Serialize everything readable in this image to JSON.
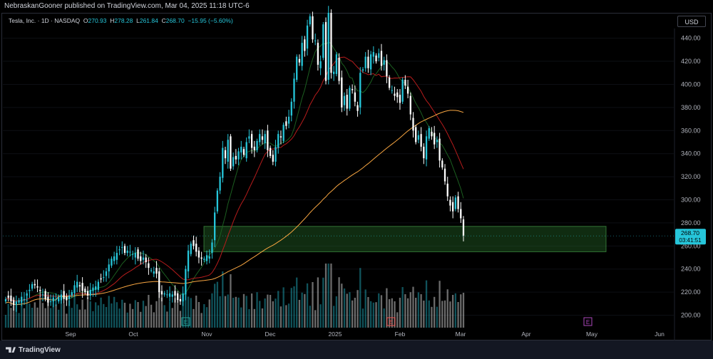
{
  "header": {
    "published": "NebraskanGooner published on TradingView.com, Mar 04, 2025 11:18 UTC-6"
  },
  "legend": {
    "symbol": "Tesla, Inc. · 1D · NASDAQ",
    "o_label": "O",
    "o": "270.93",
    "h_label": "H",
    "h": "278.28",
    "l_label": "L",
    "l": "261.84",
    "c_label": "C",
    "c": "268.70",
    "chg": "−15.95 (−5.60%)"
  },
  "currency": "USD",
  "price_label": {
    "price": "268.70",
    "countdown": "03:41:51"
  },
  "footer": {
    "brand": "TradingView"
  },
  "colors": {
    "up": "#26c6da",
    "down": "#ffffff",
    "ma_fast": "#1b5e20",
    "ma_mid": "#b71c1c",
    "ma_slow": "#f7a541",
    "zone": "#2e7d32",
    "earnings_green": "#26a69a",
    "earnings_red": "#ef5350",
    "earnings_purple": "#ab47bc"
  },
  "chart_data": {
    "type": "candlestick",
    "y_ticks": [
      200,
      220,
      240,
      260,
      280,
      300,
      320,
      340,
      360,
      380,
      400,
      420,
      440
    ],
    "y_tick_labels": [
      "200.00",
      "220.00",
      "240.00",
      "260.00",
      "280.00",
      "300.00",
      "320.00",
      "340.00",
      "360.00",
      "380.00",
      "400.00",
      "420.00",
      "440.00"
    ],
    "ylim": [
      188,
      462
    ],
    "x_labels": [
      "Sep",
      "Oct",
      "Nov",
      "Dec",
      "2025",
      "Feb",
      "Mar",
      "Apr",
      "May",
      "Jun"
    ],
    "last_close": 268.7,
    "support_zone": {
      "low": 255,
      "high": 277
    },
    "earnings_markers": [
      {
        "label": "E",
        "kind": "past"
      },
      {
        "label": "E",
        "kind": "past-red"
      },
      {
        "label": "E",
        "kind": "upcoming"
      }
    ],
    "closes": [
      214,
      215,
      212,
      209,
      212,
      213,
      216,
      214,
      219,
      222,
      227,
      226,
      224,
      221,
      218,
      214,
      211,
      212,
      215,
      214,
      216,
      218,
      214,
      213,
      217,
      220,
      226,
      229,
      225,
      221,
      220,
      217,
      222,
      224,
      225,
      229,
      231,
      233,
      238,
      244,
      249,
      251,
      254,
      257,
      259,
      254,
      256,
      255,
      253,
      254,
      249,
      247,
      250,
      246,
      241,
      239,
      238,
      236,
      220,
      218,
      219,
      218,
      219,
      218,
      217,
      213,
      212,
      219,
      240,
      256,
      262,
      260,
      255,
      250,
      249,
      249,
      252,
      251,
      263,
      289,
      308,
      320,
      345,
      336,
      352,
      327,
      337,
      335,
      342,
      346,
      339,
      350,
      355,
      345,
      343,
      351,
      357,
      352,
      357,
      343,
      338,
      333,
      346,
      357,
      354,
      365,
      364,
      372,
      385,
      405,
      424,
      419,
      436,
      429,
      451,
      459,
      439,
      438,
      417,
      420,
      452,
      403,
      462,
      410,
      411,
      426,
      403,
      380,
      390,
      379,
      397,
      395,
      385,
      377,
      410,
      413,
      424,
      414,
      426,
      428,
      420,
      427,
      416,
      421,
      407,
      397,
      395,
      390,
      389,
      384,
      404,
      399,
      392,
      374,
      360,
      350,
      356,
      346,
      336,
      355,
      362,
      355,
      348,
      352,
      334,
      328,
      316,
      303,
      295,
      290,
      302,
      292,
      284,
      269
    ]
  }
}
